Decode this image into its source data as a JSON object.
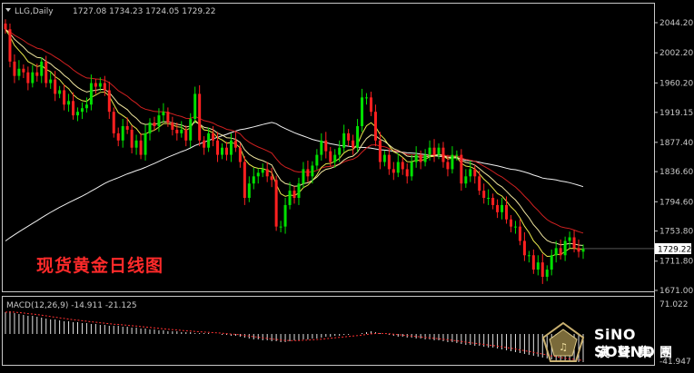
{
  "header": {
    "symbol": "LLG,Daily",
    "ohlc": "1727.08 1734.23 1724.05 1729.22"
  },
  "overlay_title": "现货黄金日线图",
  "macd": {
    "label": "MACD(12,26,9) -14.911 -21.125"
  },
  "logo": {
    "name_en": "SiNO SOUND",
    "name_cn": "漢聲集團"
  },
  "colors": {
    "background": "#000000",
    "text": "#c8c8c8",
    "bull": "#00e000",
    "bear": "#ff2020",
    "ma_white": "#f0f0f0",
    "ma_red": "#d02020",
    "ma_yellow": "#e6e64a",
    "ma_cream": "#f0e6a0",
    "title": "#ff2a2a",
    "current_price_bg": "#ffffff"
  },
  "chart_data": {
    "type": "candlestick",
    "title": "LLG,Daily",
    "y_ticks": [
      "2044.20",
      "2002.20",
      "1960.20",
      "1919.15",
      "1877.40",
      "1836.60",
      "1794.60",
      "1753.80",
      "1711.80",
      "1671.00"
    ],
    "current_price": "1729.22",
    "macd_ticks": [
      "71.022",
      "-41.947"
    ],
    "ylim": [
      1660,
      2066
    ],
    "price_closes": [
      2035,
      1990,
      1970,
      1980,
      1975,
      1960,
      1975,
      1970,
      1990,
      1960,
      1965,
      1945,
      1950,
      1930,
      1935,
      1915,
      1920,
      1925,
      1930,
      1960,
      1955,
      1960,
      1950,
      1920,
      1890,
      1880,
      1900,
      1895,
      1870,
      1880,
      1860,
      1890,
      1905,
      1900,
      1915,
      1920,
      1905,
      1895,
      1890,
      1895,
      1880,
      1910,
      1945,
      1880,
      1870,
      1890,
      1880,
      1860,
      1870,
      1860,
      1880,
      1870,
      1850,
      1800,
      1820,
      1830,
      1835,
      1840,
      1830,
      1825,
      1760,
      1760,
      1790,
      1810,
      1800,
      1820,
      1840,
      1830,
      1845,
      1860,
      1880,
      1865,
      1850,
      1860,
      1870,
      1890,
      1880,
      1870,
      1900,
      1940,
      1940,
      1920,
      1880,
      1850,
      1860,
      1840,
      1835,
      1850,
      1840,
      1830,
      1850,
      1860,
      1850,
      1860,
      1870,
      1860,
      1870,
      1850,
      1840,
      1860,
      1860,
      1820,
      1830,
      1840,
      1830,
      1810,
      1800,
      1800,
      1790,
      1780,
      1790,
      1770,
      1760,
      1760,
      1740,
      1720,
      1720,
      1700,
      1710,
      1690,
      1700,
      1720,
      1730,
      1720,
      1740,
      1745,
      1730,
      1725,
      1729
    ],
    "macd_histogram": [
      24,
      25,
      23,
      22,
      21,
      20,
      20,
      19,
      18,
      17,
      16,
      16,
      15,
      14,
      14,
      13,
      13,
      12,
      12,
      11,
      11,
      10,
      10,
      9,
      9,
      9,
      8,
      8,
      7,
      7,
      6,
      6,
      5,
      5,
      4,
      4,
      3,
      3,
      3,
      2,
      2,
      2,
      1,
      1,
      1,
      1,
      0,
      0,
      -1,
      -1,
      -2,
      -2,
      -3,
      -4,
      -5,
      -6,
      -6,
      -7,
      -7,
      -8,
      -8,
      -9,
      -9,
      -8,
      -7,
      -7,
      -6,
      -6,
      -5,
      -5,
      -4,
      -3,
      -3,
      -2,
      -2,
      -1,
      -1,
      0,
      0,
      1,
      2,
      3,
      2,
      1,
      0,
      -1,
      -2,
      -3,
      -3,
      -4,
      -4,
      -5,
      -5,
      -6,
      -6,
      -7,
      -7,
      -8,
      -9,
      -9,
      -10,
      -11,
      -12,
      -12,
      -13,
      -13,
      -14,
      -15,
      -15,
      -16,
      -17,
      -18,
      -19,
      -20,
      -21,
      -22,
      -23,
      -24,
      -25,
      -26,
      -27,
      -28,
      -29,
      -29,
      -30,
      -30,
      -31,
      -31,
      -31
    ]
  }
}
